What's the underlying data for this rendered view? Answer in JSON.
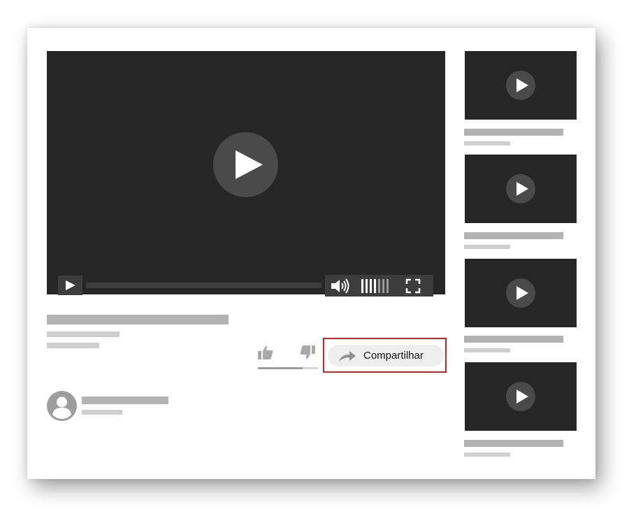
{
  "main_video": {
    "share_button_label": "Compartilhar",
    "highlight_color": "#e01b1b",
    "rating_like_fraction": 0.74
  },
  "icons": {
    "big_play": "play-icon",
    "control_play": "play-icon",
    "volume": "volume-icon",
    "volume_levels": "volume-level-icon",
    "fullscreen": "fullscreen-icon",
    "like": "thumbs-up-icon",
    "dislike": "thumbs-down-icon",
    "share": "share-arrow-icon",
    "avatar": "user-avatar-icon"
  },
  "recommendations": [
    {
      "thumbnail_icon": "play-icon"
    },
    {
      "thumbnail_icon": "play-icon"
    },
    {
      "thumbnail_icon": "play-icon"
    },
    {
      "thumbnail_icon": "play-icon"
    }
  ],
  "colors": {
    "player_background": "#262626",
    "control_background": "#3d3d3d",
    "placeholder_text": "#b3b3b3",
    "share_button_background": "#eeeeee"
  }
}
